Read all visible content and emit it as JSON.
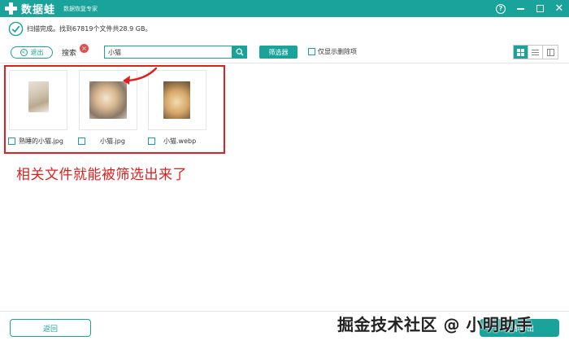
{
  "titlebar": {
    "app_name": "数据蛙",
    "subtitle": "数据恢复专家",
    "help_glyph": "?",
    "close_glyph": "✕",
    "bg_color": "#1aa39a"
  },
  "status": {
    "text": "扫描完成。找到67819个文件共28.9 GB。"
  },
  "toolbar": {
    "back_label": "退出",
    "back_glyph": "<",
    "search_label": "搜索",
    "clear_glyph": "×",
    "search_value": "小猫",
    "filter_label": "筛选器",
    "deleted_only_label": "仅显示删除项",
    "views": [
      "grid-view-icon",
      "list-view-icon",
      "detail-view-icon"
    ],
    "active_view": "grid-view-icon"
  },
  "files": [
    {
      "name": "熟睡的小猫.jpg",
      "checked": false
    },
    {
      "name": "小猫.jpg",
      "checked": false
    },
    {
      "name": "小猫.webp",
      "checked": false
    }
  ],
  "annotation": {
    "text": "相关文件就能被筛选出来了",
    "color": "#e02020"
  },
  "footer": {
    "return_label": "返回",
    "recover_label": "立即导出"
  },
  "watermark": {
    "text": "掘金技术社区 @ 小明助手"
  }
}
